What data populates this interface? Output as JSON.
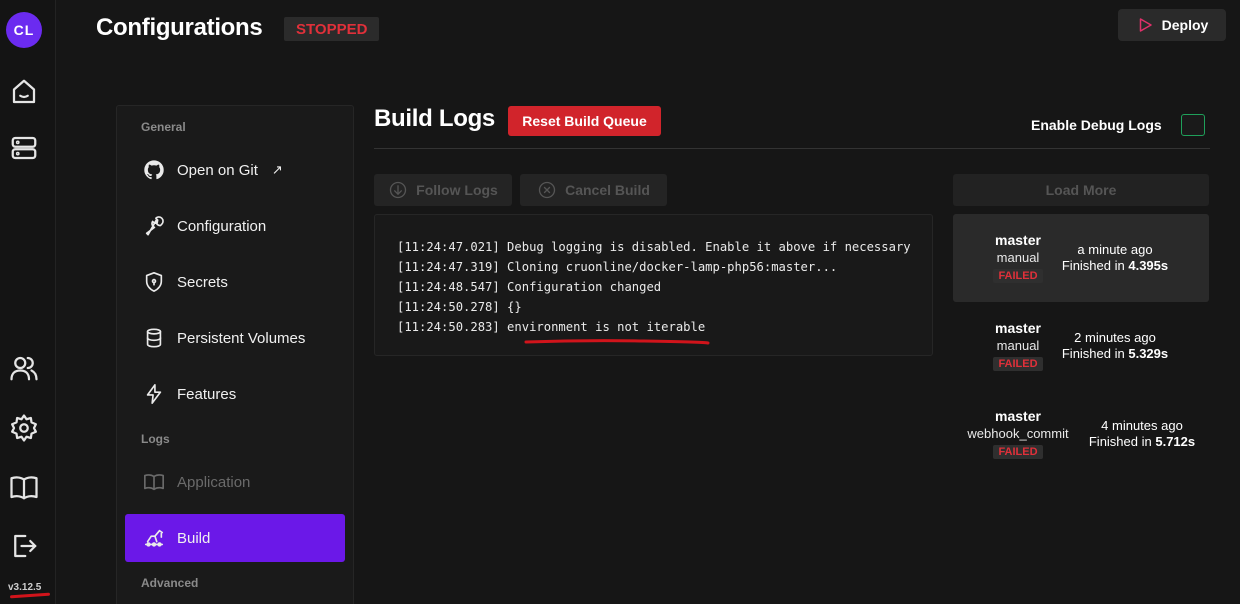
{
  "app": {
    "logo_text": "CL",
    "version": "v3.12.5"
  },
  "header": {
    "title": "Configurations",
    "status": "STOPPED",
    "deploy_label": "Deploy"
  },
  "sidebar": {
    "sections": {
      "general": "General",
      "logs": "Logs",
      "advanced": "Advanced"
    },
    "items": [
      {
        "label": "Open on Git",
        "icon": "github-icon"
      },
      {
        "label": "Configuration",
        "icon": "wrench-icon"
      },
      {
        "label": "Secrets",
        "icon": "shield-icon"
      },
      {
        "label": "Persistent Volumes",
        "icon": "database-icon"
      },
      {
        "label": "Features",
        "icon": "bolt-icon"
      },
      {
        "label": "Application",
        "icon": "book-icon"
      },
      {
        "label": "Build",
        "icon": "build-icon"
      }
    ]
  },
  "build_logs": {
    "title": "Build Logs",
    "reset_label": "Reset Build Queue",
    "debug_label": "Enable Debug Logs",
    "follow_label": "Follow Logs",
    "cancel_label": "Cancel Build",
    "lines": [
      "[11:24:47.021] Debug logging is disabled. Enable it above if necessary",
      "[11:24:47.319] Cloning cruonline/docker-lamp-php56:master...",
      "[11:24:48.547] Configuration changed",
      "[11:24:50.278] {}",
      "[11:24:50.283] environment is not iterable"
    ]
  },
  "builds": {
    "load_more": "Load More",
    "items": [
      {
        "branch": "master",
        "type": "manual",
        "status": "FAILED",
        "ago": "a minute ago",
        "finished_prefix": "Finished in",
        "duration": "4.395s"
      },
      {
        "branch": "master",
        "type": "manual",
        "status": "FAILED",
        "ago": "2 minutes ago",
        "finished_prefix": "Finished in",
        "duration": "5.329s"
      },
      {
        "branch": "master",
        "type": "webhook_commit",
        "status": "FAILED",
        "ago": "4 minutes ago",
        "finished_prefix": "Finished in",
        "duration": "5.712s"
      }
    ]
  },
  "colors": {
    "accent": "#6b18e8",
    "danger": "#d1242b",
    "status_red": "#e0303a",
    "debug_checkbox": "#1fa05a"
  }
}
